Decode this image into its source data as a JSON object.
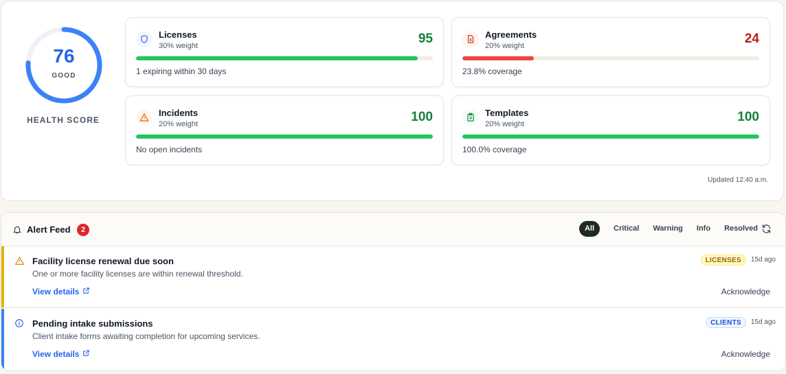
{
  "health": {
    "score": "76",
    "score_value": 76,
    "status": "GOOD",
    "caption": "HEALTH SCORE",
    "accent": "#2563eb",
    "updated": "Updated 12:40 a.m."
  },
  "metrics": [
    {
      "title": "Licenses",
      "weight": "30% weight",
      "score": "95",
      "score_value": 95,
      "note": "1 expiring within 30 days",
      "score_color": "#15803d",
      "bar_color": "#22c55e",
      "icon": "shield-icon"
    },
    {
      "title": "Agreements",
      "weight": "20% weight",
      "score": "24",
      "score_value": 24,
      "note": "23.8% coverage",
      "score_color": "#b91c1c",
      "bar_color": "#ef4444",
      "icon": "document-icon"
    },
    {
      "title": "Incidents",
      "weight": "20% weight",
      "score": "100",
      "score_value": 100,
      "note": "No open incidents",
      "score_color": "#15803d",
      "bar_color": "#22c55e",
      "icon": "warning-icon"
    },
    {
      "title": "Templates",
      "weight": "20% weight",
      "score": "100",
      "score_value": 100,
      "note": "100.0% coverage",
      "score_color": "#15803d",
      "bar_color": "#22c55e",
      "icon": "clipboard-icon"
    }
  ],
  "alert_feed": {
    "title": "Alert Feed",
    "count": "2",
    "filters": [
      "All",
      "Critical",
      "Warning",
      "Info",
      "Resolved"
    ],
    "active_filter": "All",
    "alerts": [
      {
        "title": "Facility license renewal due soon",
        "description": "One or more facility licenses are within renewal threshold.",
        "tag": "LICENSES",
        "time": "15d ago",
        "link": "View details",
        "action": "Acknowledge",
        "severity": "warning",
        "stripe_color": "#eab308",
        "icon": "warning-icon"
      },
      {
        "title": "Pending intake submissions",
        "description": "Client intake forms awaiting completion for upcoming services.",
        "tag": "CLIENTS",
        "time": "15d ago",
        "link": "View details",
        "action": "Acknowledge",
        "severity": "info",
        "stripe_color": "#3b82f6",
        "icon": "info-icon"
      }
    ]
  }
}
